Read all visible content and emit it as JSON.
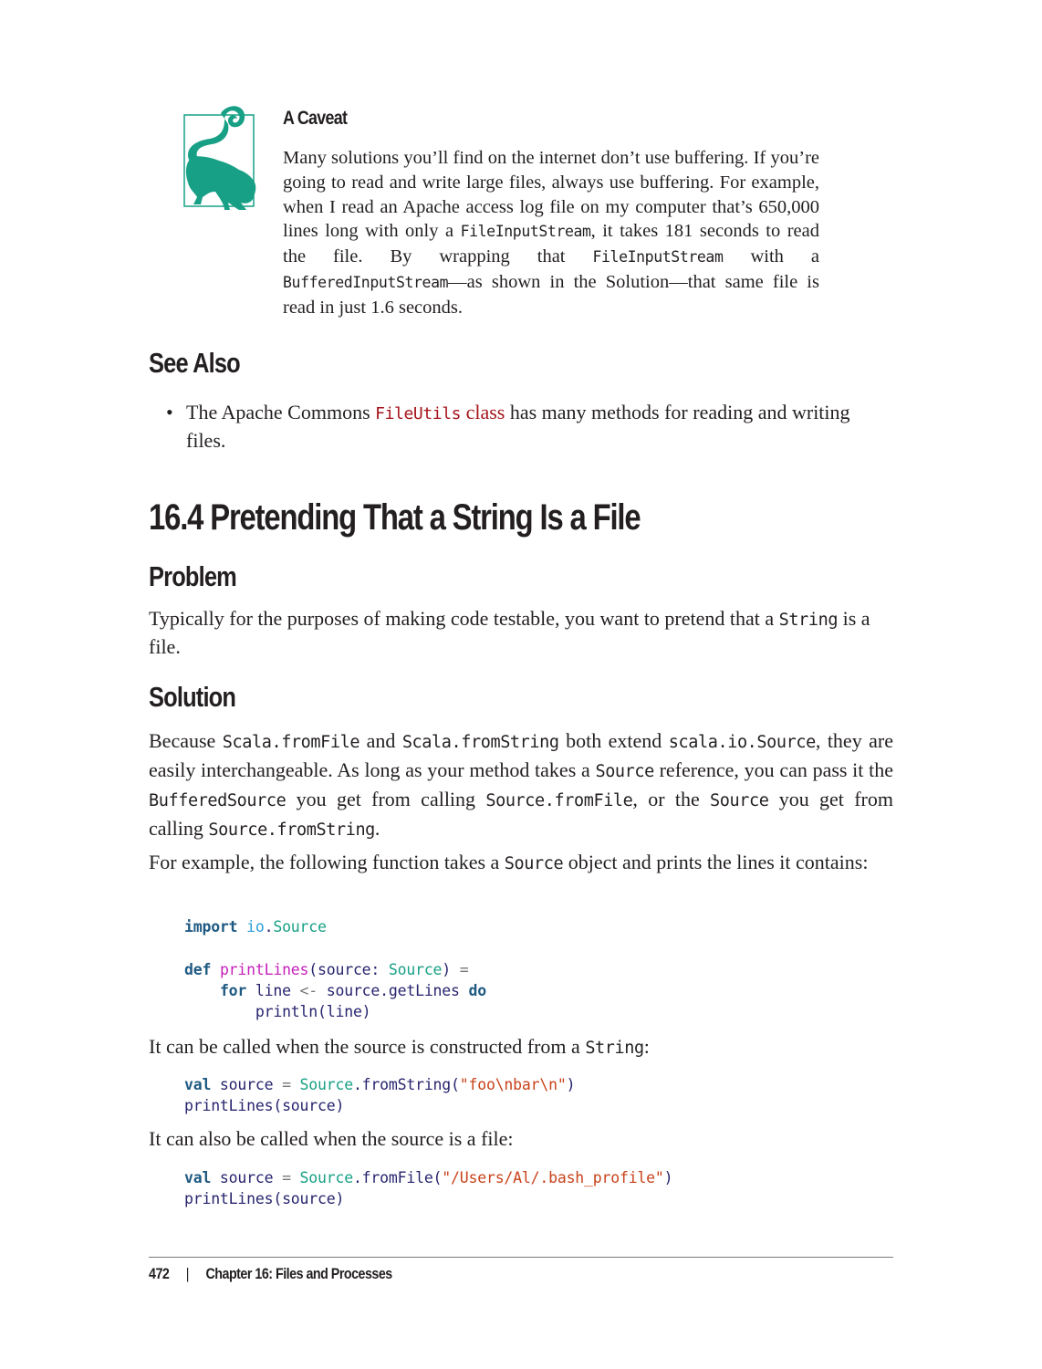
{
  "note": {
    "icon": "lemur-icon",
    "icon_color": "#17a085",
    "title": "A Caveat",
    "body": {
      "t1": "Many solutions you’ll find on the internet don’t use buffering. If you’re going to read and write large files, always use buffering. For example, when I read an Apache access log file on my computer that’s 650,000 lines long with only a ",
      "c1": "FileInputStream",
      "t2": ", it takes 181 seconds to read the file. By wrapping that ",
      "c2": "FileInputStream",
      "t3": " with a ",
      "c3": "BufferedInputStream",
      "t4": "—as shown in the Solution—that same file is read in just 1.6 seconds."
    }
  },
  "see_also": {
    "heading": "See Also",
    "items": [
      {
        "bullet": "•",
        "t1": "The Apache Commons ",
        "link_code": "FileUtils",
        "link_text": " class",
        "t2": " has many methods for reading and writing files."
      }
    ]
  },
  "recipe": {
    "title": "16.4 Pretending That a String Is a File"
  },
  "problem": {
    "heading": "Problem",
    "t1": "Typically for the purposes of making code testable, you want to pretend that a ",
    "c1": "String",
    "t2": " is a file."
  },
  "solution": {
    "heading": "Solution",
    "p1": {
      "t1": "Because ",
      "c1": "Scala.fromFile",
      "t2": " and ",
      "c2": "Scala.fromString",
      "t3": " both extend ",
      "c3": "scala.io.Source",
      "t4": ", they are easily interchangeable. As long as your method takes a ",
      "c4": "Source",
      "t5": " reference, you can pass it the ",
      "c5": "BufferedSource",
      "t6": " you get from calling ",
      "c6": "Source.fromFile",
      "t7": ", or the ",
      "c7": "Source",
      "t8": " you get from calling ",
      "c8": "Source.fromString",
      "t9": "."
    },
    "p2": {
      "t1": "For example, the following function takes a ",
      "c1": "Source",
      "t2": " object and prints the lines it contains:"
    },
    "code1": {
      "l1": [
        "import",
        " ",
        "io",
        ".",
        "Source"
      ],
      "l3": [
        "def",
        " ",
        "printLines",
        "(source: ",
        "Source",
        ") ",
        "="
      ],
      "l4": [
        "    ",
        "for",
        " line ",
        "<-",
        " source.getLines ",
        "do"
      ],
      "l5": [
        "        println(line)"
      ]
    },
    "called_string": {
      "t1": "It can be called when the source is constructed from a ",
      "c1": "String",
      "t2": ":"
    },
    "code2": {
      "l1": [
        "val",
        " source ",
        "=",
        " ",
        "Source",
        ".fromString(",
        "\"foo\\nbar\\n\"",
        ")"
      ],
      "l2": [
        "printLines(source)"
      ]
    },
    "called_file": {
      "t1": "It can also be called when the source is a file:"
    },
    "code3": {
      "l1": [
        "val",
        " source ",
        "=",
        " ",
        "Source",
        ".fromFile(",
        "\"/Users/Al/.bash_profile\"",
        ")"
      ],
      "l2": [
        "printLines(source)"
      ]
    }
  },
  "footer": {
    "page_number": "472",
    "separator": "|",
    "chapter": "Chapter 16: Files and Processes"
  }
}
